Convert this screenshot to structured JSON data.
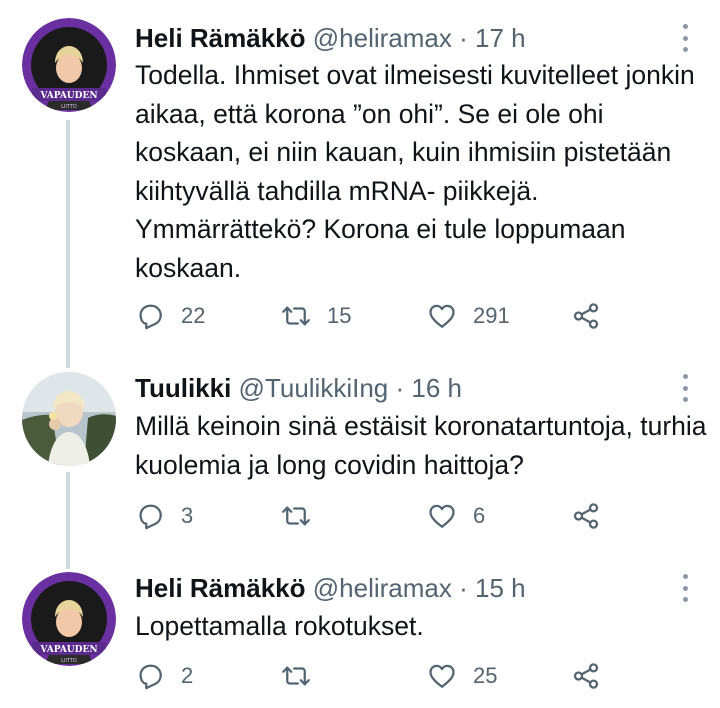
{
  "tweets": [
    {
      "name": "Heli Rämäkkö",
      "handle": "@heliramax",
      "separator": "·",
      "time": "17 h",
      "text": "Todella. Ihmiset ovat ilmeisesti kuvitelleet jonkin aikaa, että korona ”on ohi”. Se ei ole ohi koskaan, ei niin kauan, kuin ihmisiin pistetään kiihtyvällä tahdilla mRNA- piikkejä. Ymmärrättekö? Korona  ei tule loppumaan koskaan.",
      "avatar_label": "VAPAUDEN",
      "avatar_sublabel": "LIITTO",
      "replies": "22",
      "retweets": "15",
      "likes": "291"
    },
    {
      "name": "Tuulikki",
      "handle": "@TuulikkiIng",
      "separator": "·",
      "time": "16 h",
      "text": "Millä keinoin sinä estäisit koronatartuntoja, turhia kuolemia ja long covidin haittoja?",
      "replies": "3",
      "retweets": "",
      "likes": "6"
    },
    {
      "name": "Heli Rämäkkö",
      "handle": "@heliramax",
      "separator": "·",
      "time": "15 h",
      "text": "Lopettamalla rokotukset.",
      "avatar_label": "VAPAUDEN",
      "avatar_sublabel": "LIITTO",
      "replies": "2",
      "retweets": "",
      "likes": "25"
    }
  ],
  "icons": {
    "reply": "reply-icon",
    "retweet": "retweet-icon",
    "like": "like-icon",
    "share": "share-icon",
    "more": "more-options-icon"
  },
  "colors": {
    "text": "#0f1419",
    "secondary": "#536471",
    "thread_line": "#cfd9de",
    "avatar_ring": "#6a2fa0",
    "avatar_banner": "#5a2a8c"
  }
}
